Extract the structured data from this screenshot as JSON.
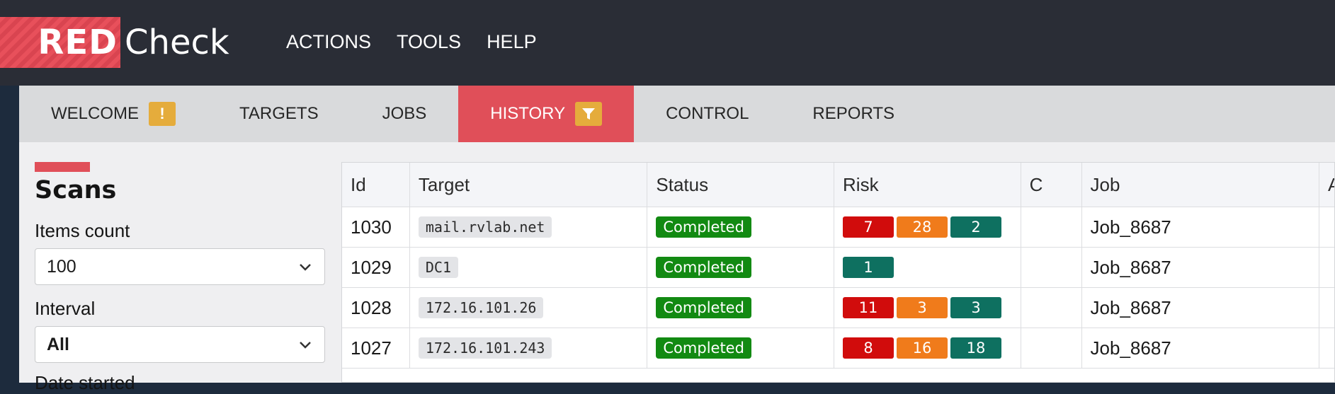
{
  "app": {
    "logo_red": "RED",
    "logo_rest": "Check"
  },
  "menu": [
    {
      "label": "ACTIONS"
    },
    {
      "label": "TOOLS"
    },
    {
      "label": "HELP"
    }
  ],
  "tabs": [
    {
      "label": "WELCOME",
      "badge": "!"
    },
    {
      "label": "TARGETS"
    },
    {
      "label": "JOBS"
    },
    {
      "label": "HISTORY",
      "active": true,
      "icon": "filter-icon"
    },
    {
      "label": "CONTROL"
    },
    {
      "label": "REPORTS"
    }
  ],
  "sidebar": {
    "title": "Scans",
    "items_count_label": "Items count",
    "items_count_value": "100",
    "interval_label": "Interval",
    "interval_value": "All",
    "date_label": "Date started"
  },
  "table": {
    "columns": [
      "Id",
      "Target",
      "Status",
      "Risk",
      "C",
      "Job",
      "A"
    ],
    "rows": [
      {
        "id": "1030",
        "target": "mail.rvlab.net",
        "status": "Completed",
        "risk_high": "7",
        "risk_med": "28",
        "risk_low": "2",
        "c": "",
        "job": "Job_8687"
      },
      {
        "id": "1029",
        "target": "DC1",
        "status": "Completed",
        "risk_high": "",
        "risk_med": "",
        "risk_low": "1",
        "c": "",
        "job": "Job_8687"
      },
      {
        "id": "1028",
        "target": "172.16.101.26",
        "status": "Completed",
        "risk_high": "11",
        "risk_med": "3",
        "risk_low": "3",
        "c": "",
        "job": "Job_8687"
      },
      {
        "id": "1027",
        "target": "172.16.101.243",
        "status": "Completed",
        "risk_high": "8",
        "risk_med": "16",
        "risk_low": "18",
        "c": "",
        "job": "Job_8687"
      }
    ]
  },
  "colors": {
    "brand_red": "#e04f59",
    "topbar": "#2a2d36",
    "status_completed": "#128a12",
    "risk_high": "#d10c0c",
    "risk_medium": "#f07b1b",
    "risk_low": "#0e7060",
    "warning_badge": "#e5ac3c"
  }
}
